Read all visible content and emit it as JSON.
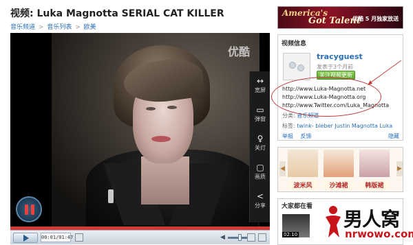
{
  "page": {
    "title": "视频: Luka Magnotta SERIAL CAT KILLER",
    "breadcrumb": [
      "音乐频道",
      "音乐列表",
      "欧美"
    ],
    "breadcrumb_sep": ">"
  },
  "player": {
    "watermark": "优酷",
    "time": "00:01/01:47",
    "tools": [
      {
        "icon": "expand-icon",
        "label": "宽屏"
      },
      {
        "icon": "comment-icon",
        "label": "弹窗"
      },
      {
        "icon": "lamp-icon",
        "label": "关灯"
      },
      {
        "icon": "screen-icon",
        "label": "画质"
      },
      {
        "icon": "share-icon",
        "label": "分享"
      }
    ],
    "playing": true
  },
  "banner": {
    "brand": "America's",
    "talent": "Got Talent",
    "promo": "优酷 5 月独家放送"
  },
  "info": {
    "title": "视频信息",
    "user": "tracyguest",
    "posted": "发表于3个月前",
    "subscribe": "关注视频更新",
    "urls": [
      "http://www.Luka-Magnotta.net",
      "http://www.Luka-Magnotta.org",
      "http://www.Twitter.com/Luka_Magnotta"
    ],
    "category_label": "分类:",
    "category": "音乐频道",
    "tags_label": "标签:",
    "tags": "twink- bieber Justin Magnotta Luka",
    "report": "举报",
    "feedback": "反馈",
    "hide": "隐藏"
  },
  "ads": {
    "taglines": [
      "波米风",
      "沙滩裙",
      "韩版裙"
    ],
    "badge": "夏季"
  },
  "watching": {
    "title": "大家都在看",
    "thumb_time": "02:10"
  },
  "logo": {
    "text": "男人窝",
    "domain": "nrwowo.com"
  },
  "colors": {
    "link": "#2a6fb5",
    "progress": "#d23a33",
    "annotation": "#c23a3a"
  }
}
